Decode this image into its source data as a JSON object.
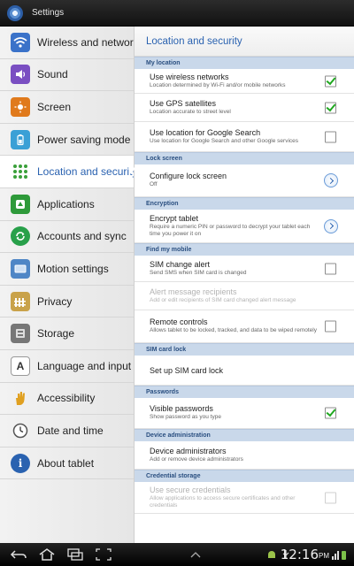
{
  "titlebar": {
    "title": "Settings"
  },
  "sidebar": {
    "items": [
      {
        "label": "Wireless and networks",
        "icon": "wifi-icon",
        "color": "#3a72c9"
      },
      {
        "label": "Sound",
        "icon": "speaker-icon",
        "color": "#7a4fc2"
      },
      {
        "label": "Screen",
        "icon": "brightness-icon",
        "color": "#e07a1c"
      },
      {
        "label": "Power saving mode",
        "icon": "battery-icon",
        "color": "#3aa0d6"
      },
      {
        "label": "Location and security",
        "icon": "location-grid-icon",
        "color": "#3aa03a"
      },
      {
        "label": "Applications",
        "icon": "applications-icon",
        "color": "#2e9a3a"
      },
      {
        "label": "Accounts and sync",
        "icon": "sync-icon",
        "color": "#28a04a"
      },
      {
        "label": "Motion settings",
        "icon": "tablet-motion-icon",
        "color": "#4f86c6"
      },
      {
        "label": "Privacy",
        "icon": "fence-icon",
        "color": "#c9a24a"
      },
      {
        "label": "Storage",
        "icon": "storage-icon",
        "color": "#777777"
      },
      {
        "label": "Language and input",
        "icon": "keyboard-icon",
        "color": "#5a5a5a"
      },
      {
        "label": "Accessibility",
        "icon": "hand-icon",
        "color": "#e0a020"
      },
      {
        "label": "Date and time",
        "icon": "clock-icon",
        "color": "#555555"
      },
      {
        "label": "About tablet",
        "icon": "info-icon",
        "color": "#2a62b0"
      }
    ],
    "selected_index": 4
  },
  "main": {
    "title": "Location and security",
    "sections": {
      "my_location": "My location",
      "lock_screen": "Lock screen",
      "encryption": "Encryption",
      "find_my_mobile": "Find my mobile",
      "sim_card_lock": "SIM card lock",
      "passwords": "Passwords",
      "device_admin": "Device administration",
      "credential_storage": "Credential storage"
    },
    "rows": {
      "wireless": {
        "title": "Use wireless networks",
        "summary": "Location determined by Wi-Fi and/or mobile networks",
        "checked": true
      },
      "gps": {
        "title": "Use GPS satellites",
        "summary": "Location accurate to street level",
        "checked": true
      },
      "google": {
        "title": "Use location for Google Search",
        "summary": "Use location for Google Search and other Google services",
        "checked": false
      },
      "lock": {
        "title": "Configure lock screen",
        "summary": "Off"
      },
      "encrypt": {
        "title": "Encrypt tablet",
        "summary": "Require a numeric PIN or password to decrypt your tablet each time you power it on"
      },
      "sim_alert": {
        "title": "SIM change alert",
        "summary": "Send SMS when SIM card is changed",
        "checked": false
      },
      "alert_recipients": {
        "title": "Alert message recipients",
        "summary": "Add or edit recipients of SIM card changed alert message"
      },
      "remote": {
        "title": "Remote controls",
        "summary": "Allows tablet to be locked, tracked, and data to be wiped remotely",
        "checked": false
      },
      "sim_lock": {
        "title": "Set up SIM card lock"
      },
      "visible_pw": {
        "title": "Visible passwords",
        "summary": "Show password as you type",
        "checked": true
      },
      "device_admins": {
        "title": "Device administrators",
        "summary": "Add or remove device administrators"
      },
      "secure_creds": {
        "title": "Use secure credentials",
        "summary": "Allow applications to access secure certificates and other credentials",
        "checked": false
      }
    }
  },
  "statusbar": {
    "time": "12:16",
    "ampm": "PM"
  }
}
